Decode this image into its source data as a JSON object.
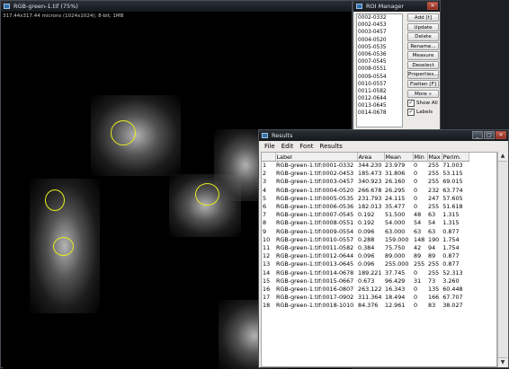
{
  "image_window": {
    "title": "RGB-green-1.tif (75%)",
    "info": "317.44x317.44 microns (1024x1024); 8-bit; 1MB"
  },
  "roi_manager": {
    "title": "ROI Manager",
    "items": [
      "0002-0332",
      "0002-0453",
      "0003-0457",
      "0004-0520",
      "0005-0535",
      "0006-0536",
      "0007-0545",
      "0008-0551",
      "0009-0554",
      "0010-0557",
      "0011-0582",
      "0012-0644",
      "0013-0645",
      "0014-0678"
    ],
    "buttons": [
      "Add [t]",
      "Update",
      "Delete",
      "Rename...",
      "Measure",
      "Deselect",
      "Properties...",
      "Flatten [F]",
      "More »"
    ],
    "show_all_label": "Show All",
    "labels_label": "Labels",
    "show_all_checked": true,
    "labels_checked": true
  },
  "results": {
    "title": "Results",
    "menu": [
      "File",
      "Edit",
      "Font",
      "Results"
    ],
    "columns": [
      "",
      "Label",
      "Area",
      "Mean",
      "Min",
      "Max",
      "Perim."
    ],
    "rows": [
      [
        "1",
        "RGB-green-1.tif:0001-0332",
        "344.230",
        "23.979",
        "0",
        "255",
        "71.003"
      ],
      [
        "2",
        "RGB-green-1.tif:0002-0453",
        "185.473",
        "31.806",
        "0",
        "255",
        "53.115"
      ],
      [
        "3",
        "RGB-green-1.tif:0003-0457",
        "340.923",
        "26.160",
        "0",
        "255",
        "69.015"
      ],
      [
        "4",
        "RGB-green-1.tif:0004-0520",
        "266.678",
        "26.295",
        "0",
        "232",
        "63.774"
      ],
      [
        "5",
        "RGB-green-1.tif:0005-0535",
        "231.793",
        "24.115",
        "0",
        "247",
        "57.605"
      ],
      [
        "6",
        "RGB-green-1.tif:0006-0536",
        "182.013",
        "35.477",
        "0",
        "255",
        "51.618"
      ],
      [
        "7",
        "RGB-green-1.tif:0007-0545",
        "0.192",
        "51.500",
        "48",
        "63",
        "1.315"
      ],
      [
        "8",
        "RGB-green-1.tif:0008-0551",
        "0.192",
        "54.000",
        "54",
        "54",
        "1.315"
      ],
      [
        "9",
        "RGB-green-1.tif:0009-0554",
        "0.096",
        "63.000",
        "63",
        "63",
        "0.877"
      ],
      [
        "10",
        "RGB-green-1.tif:0010-0557",
        "0.288",
        "159.000",
        "148",
        "190",
        "1.754"
      ],
      [
        "11",
        "RGB-green-1.tif:0011-0582",
        "0.384",
        "75.750",
        "42",
        "94",
        "1.754"
      ],
      [
        "12",
        "RGB-green-1.tif:0012-0644",
        "0.096",
        "89.000",
        "89",
        "89",
        "0.877"
      ],
      [
        "13",
        "RGB-green-1.tif:0013-0645",
        "0.096",
        "255.000",
        "255",
        "255",
        "0.877"
      ],
      [
        "14",
        "RGB-green-1.tif:0014-0678",
        "189.221",
        "37.745",
        "0",
        "255",
        "52.313"
      ],
      [
        "15",
        "RGB-green-1.tif:0015-0667",
        "0.673",
        "96.429",
        "31",
        "73",
        "3.260"
      ],
      [
        "16",
        "RGB-green-1.tif:0016-0807",
        "263.122",
        "16.343",
        "0",
        "135",
        "60.448"
      ],
      [
        "17",
        "RGB-green-1.tif:0017-0902",
        "311.364",
        "18.494",
        "0",
        "166",
        "67.707"
      ],
      [
        "18",
        "RGB-green-1.tif:0018-1010",
        "84.376",
        "12.961",
        "0",
        "83",
        "38.027"
      ]
    ]
  },
  "colors": {
    "roi_outline": "#e9ec1e",
    "titlebar": "#15181c"
  }
}
